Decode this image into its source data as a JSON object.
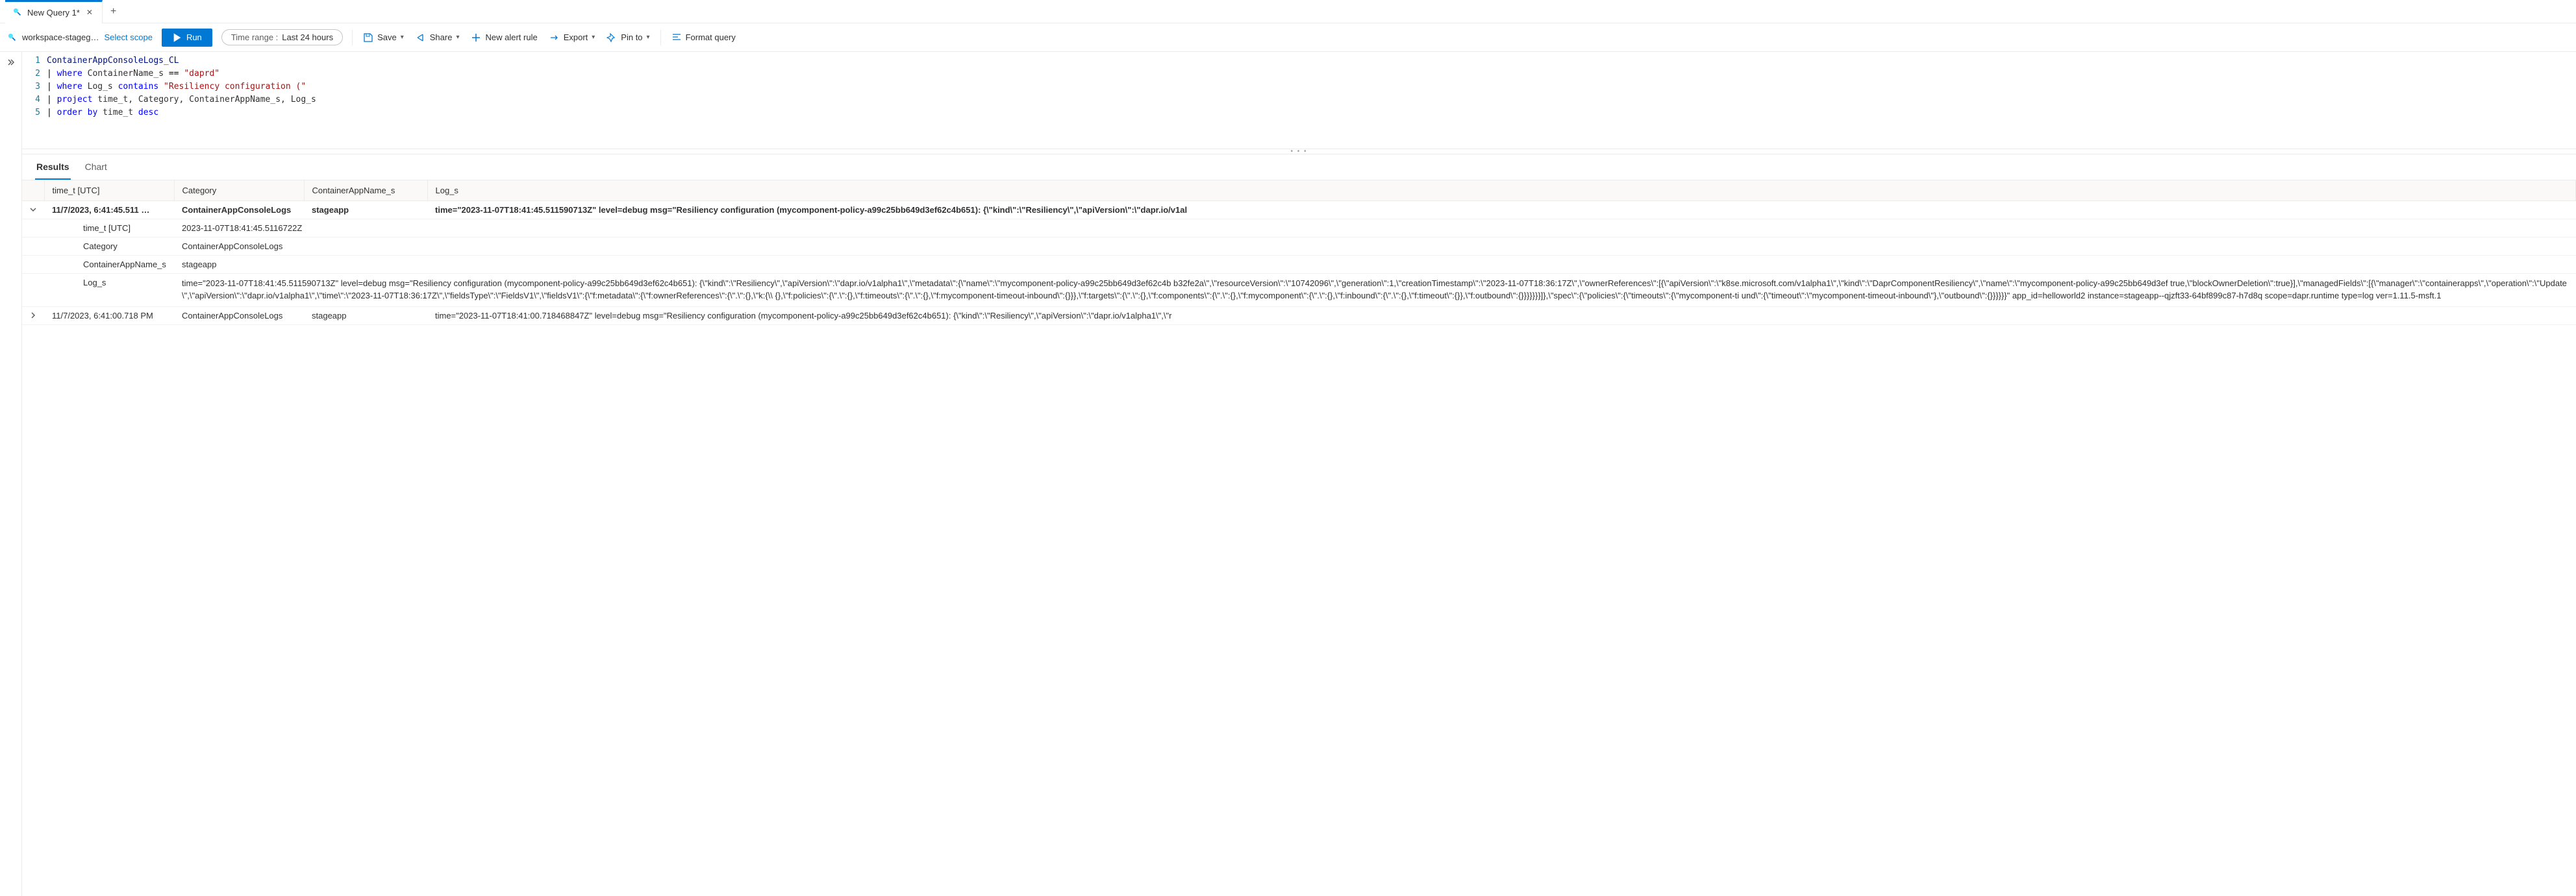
{
  "tabs": {
    "active": "New Query 1*",
    "new_tab": "+"
  },
  "scope": {
    "workspace": "workspace-stageg…",
    "select": "Select scope"
  },
  "toolbar": {
    "run": "Run",
    "time_range_label": "Time range :",
    "time_range_value": "Last 24 hours",
    "save": "Save",
    "share": "Share",
    "new_alert": "New alert rule",
    "export": "Export",
    "pin": "Pin to",
    "format": "Format query"
  },
  "editor": {
    "lines": [
      "ContainerAppConsoleLogs_CL",
      "| where ContainerName_s == \"daprd\"",
      "| where Log_s contains \"Resiliency configuration (\"",
      "| project time_t, Category, ContainerAppName_s, Log_s",
      "| order by time_t desc"
    ]
  },
  "result_tabs": {
    "results": "Results",
    "chart": "Chart"
  },
  "columns": {
    "c0": "time_t [UTC]",
    "c1": "Category",
    "c2": "ContainerAppName_s",
    "c3": "Log_s"
  },
  "rows": [
    {
      "expanded": true,
      "time": "11/7/2023, 6:41:45.511 …",
      "category": "ContainerAppConsoleLogs",
      "app": "stageapp",
      "log_short": "time=\"2023-11-07T18:41:45.511590713Z\" level=debug msg=\"Resiliency configuration (mycomponent-policy-a99c25bb649d3ef62c4b651): {\\\"kind\\\":\\\"Resiliency\\\",\\\"apiVersion\\\":\\\"dapr.io/v1al",
      "detail": {
        "time_t_label": "time_t [UTC]",
        "time_t_value": "2023-11-07T18:41:45.5116722Z",
        "category_label": "Category",
        "category_value": "ContainerAppConsoleLogs",
        "app_label": "ContainerAppName_s",
        "app_value": "stageapp",
        "log_label": "Log_s",
        "log_value": "time=\"2023-11-07T18:41:45.511590713Z\" level=debug msg=\"Resiliency configuration (mycomponent-policy-a99c25bb649d3ef62c4b651): {\\\"kind\\\":\\\"Resiliency\\\",\\\"apiVersion\\\":\\\"dapr.io/v1alpha1\\\",\\\"metadata\\\":{\\\"name\\\":\\\"mycomponent-policy-a99c25bb649d3ef62c4b b32fe2a\\\",\\\"resourceVersion\\\":\\\"10742096\\\",\\\"generation\\\":1,\\\"creationTimestamp\\\":\\\"2023-11-07T18:36:17Z\\\",\\\"ownerReferences\\\":[{\\\"apiVersion\\\":\\\"k8se.microsoft.com/v1alpha1\\\",\\\"kind\\\":\\\"DaprComponentResiliency\\\",\\\"name\\\":\\\"mycomponent-policy-a99c25bb649d3ef true,\\\"blockOwnerDeletion\\\":true}],\\\"managedFields\\\":[{\\\"manager\\\":\\\"containerapps\\\",\\\"operation\\\":\\\"Update\\\",\\\"apiVersion\\\":\\\"dapr.io/v1alpha1\\\",\\\"time\\\":\\\"2023-11-07T18:36:17Z\\\",\\\"fieldsType\\\":\\\"FieldsV1\\\",\\\"fieldsV1\\\":{\\\"f:metadata\\\":{\\\"f:ownerReferences\\\":{\\\".\\\":{},\\\"k:{\\\\ {},\\\"f:policies\\\":{\\\".\\\":{},\\\"f:timeouts\\\":{\\\".\\\":{},\\\"f:mycomponent-timeout-inbound\\\":{}}},\\\"f:targets\\\":{\\\".\\\":{},\\\"f:components\\\":{\\\".\\\":{},\\\"f:mycomponent\\\":{\\\".\\\":{},\\\"f:inbound\\\":{\\\".\\\":{},\\\"f:timeout\\\":{}},\\\"f:outbound\\\":{}}}}}}}]},\\\"spec\\\":{\\\"policies\\\":{\\\"timeouts\\\":{\\\"mycomponent-ti und\\\":{\\\"timeout\\\":\\\"mycomponent-timeout-inbound\\\"},\\\"outbound\\\":{}}}}}}\" app_id=helloworld2 instance=stageapp--qjzft33-64bf899c87-h7d8q scope=dapr.runtime type=log ver=1.11.5-msft.1"
      }
    },
    {
      "expanded": false,
      "time": "11/7/2023, 6:41:00.718 PM",
      "category": "ContainerAppConsoleLogs",
      "app": "stageapp",
      "log_short": "time=\"2023-11-07T18:41:00.718468847Z\" level=debug msg=\"Resiliency configuration (mycomponent-policy-a99c25bb649d3ef62c4b651): {\\\"kind\\\":\\\"Resiliency\\\",\\\"apiVersion\\\":\\\"dapr.io/v1alpha1\\\",\\\"r"
    }
  ]
}
